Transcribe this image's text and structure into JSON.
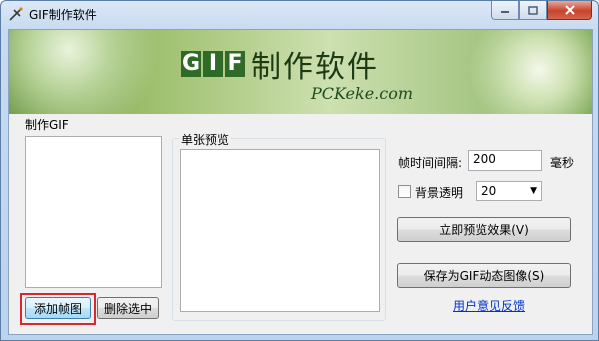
{
  "window": {
    "title": "GIF制作软件"
  },
  "banner": {
    "logo_letters": [
      "G",
      "I",
      "F"
    ],
    "title": "制作软件",
    "subtitle": "PCKeke.com"
  },
  "make_gif": {
    "group_label": "制作GIF",
    "add_frame_button": "添加帧图",
    "delete_selected_button": "删除选中"
  },
  "preview": {
    "group_label": "单张预览"
  },
  "settings": {
    "interval_label": "帧时间间隔:",
    "interval_value": "200",
    "interval_unit": "毫秒",
    "transparent_label": "背景透明",
    "transparent_checked": false,
    "transparent_value": "20",
    "preview_button": "立即预览效果(V)",
    "save_button": "保存为GIF动态图像(S)",
    "feedback_link": "用户意见反馈"
  },
  "colors": {
    "highlight": "#d9272e",
    "link": "#0033cc",
    "logo_green": "#2f6b26"
  }
}
